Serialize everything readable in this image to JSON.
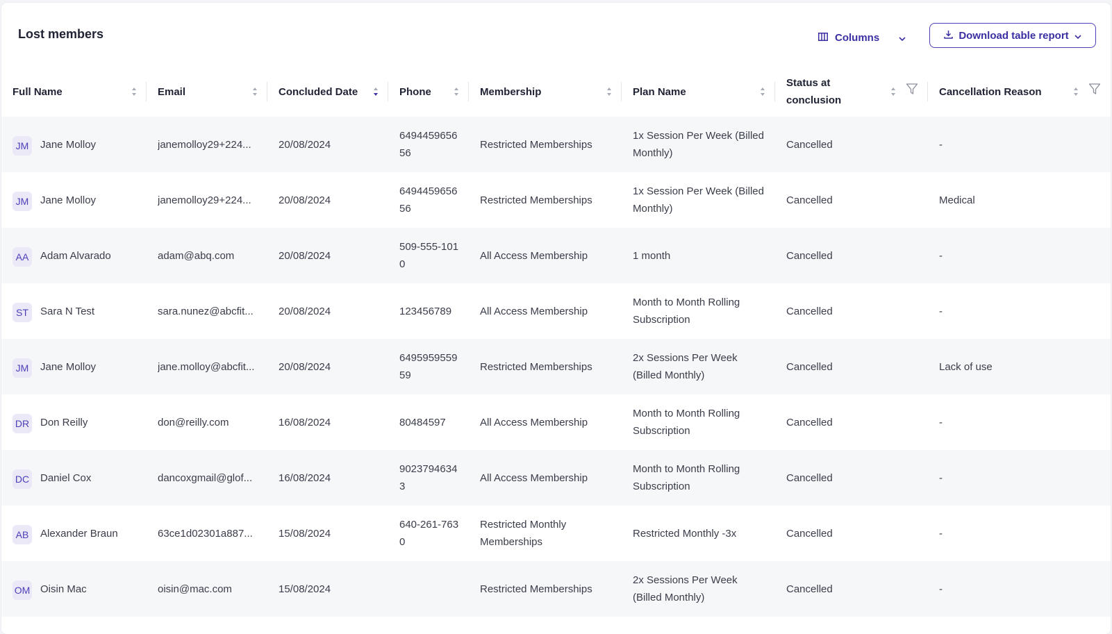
{
  "header": {
    "title": "Lost members",
    "columns_label": "Columns",
    "download_label": "Download table report"
  },
  "colors": {
    "accent": "#4b3fb8",
    "avatar_bg": "#ebe9f8",
    "row_alt": "#f6f7f9"
  },
  "columns": [
    {
      "label": "Full Name",
      "sort": "none"
    },
    {
      "label": "Email",
      "sort": "none"
    },
    {
      "label": "Concluded Date",
      "sort": "desc"
    },
    {
      "label": "Phone",
      "sort": "none"
    },
    {
      "label": "Membership",
      "sort": "none"
    },
    {
      "label": "Plan Name",
      "sort": "none"
    },
    {
      "label": "Status at conclusion",
      "sort": "none",
      "filter": true
    },
    {
      "label": "Cancellation Reason",
      "sort": "none",
      "filter": true
    }
  ],
  "rows": [
    {
      "initials": "JM",
      "name": "Jane Molloy",
      "email": "janemolloy29+224...",
      "date": "20/08/2024",
      "phone": "649445965656",
      "membership": "Restricted Memberships",
      "plan": "1x Session Per Week (Billed Monthly)",
      "status": "Cancelled",
      "reason": "-"
    },
    {
      "initials": "JM",
      "name": "Jane Molloy",
      "email": "janemolloy29+224...",
      "date": "20/08/2024",
      "phone": "649445965656",
      "membership": "Restricted Memberships",
      "plan": "1x Session Per Week (Billed Monthly)",
      "status": "Cancelled",
      "reason": "Medical"
    },
    {
      "initials": "AA",
      "name": "Adam Alvarado",
      "email": "adam@abq.com",
      "date": "20/08/2024",
      "phone": "509-555-1010",
      "membership": "All Access Membership",
      "plan": "1 month",
      "status": "Cancelled",
      "reason": "-"
    },
    {
      "initials": "ST",
      "name": "Sara N Test",
      "email": "sara.nunez@abcfit...",
      "date": "20/08/2024",
      "phone": "123456789",
      "membership": "All Access Membership",
      "plan": "Month to Month Rolling Subscription",
      "status": "Cancelled",
      "reason": "-"
    },
    {
      "initials": "JM",
      "name": "Jane Molloy",
      "email": "jane.molloy@abcfit...",
      "date": "20/08/2024",
      "phone": "649595955959",
      "membership": "Restricted Memberships",
      "plan": "2x Sessions Per Week (Billed Monthly)",
      "status": "Cancelled",
      "reason": "Lack of use"
    },
    {
      "initials": "DR",
      "name": "Don Reilly",
      "email": "don@reilly.com",
      "date": "16/08/2024",
      "phone": "80484597",
      "membership": "All Access Membership",
      "plan": "Month to Month Rolling Subscription",
      "status": "Cancelled",
      "reason": "-"
    },
    {
      "initials": "DC",
      "name": "Daniel Cox",
      "email": "dancoxgmail@glof...",
      "date": "16/08/2024",
      "phone": "90237946343",
      "membership": "All Access Membership",
      "plan": "Month to Month Rolling Subscription",
      "status": "Cancelled",
      "reason": "-"
    },
    {
      "initials": "AB",
      "name": "Alexander Braun",
      "email": "63ce1d02301a887...",
      "date": "15/08/2024",
      "phone": "640-261-7630",
      "membership": "Restricted Monthly Memberships",
      "plan": "Restricted Monthly -3x",
      "status": "Cancelled",
      "reason": "-"
    },
    {
      "initials": "OM",
      "name": "Oisin Mac",
      "email": "oisin@mac.com",
      "date": "15/08/2024",
      "phone": "",
      "membership": "Restricted Memberships",
      "plan": "2x Sessions Per Week (Billed Monthly)",
      "status": "Cancelled",
      "reason": "-"
    }
  ]
}
